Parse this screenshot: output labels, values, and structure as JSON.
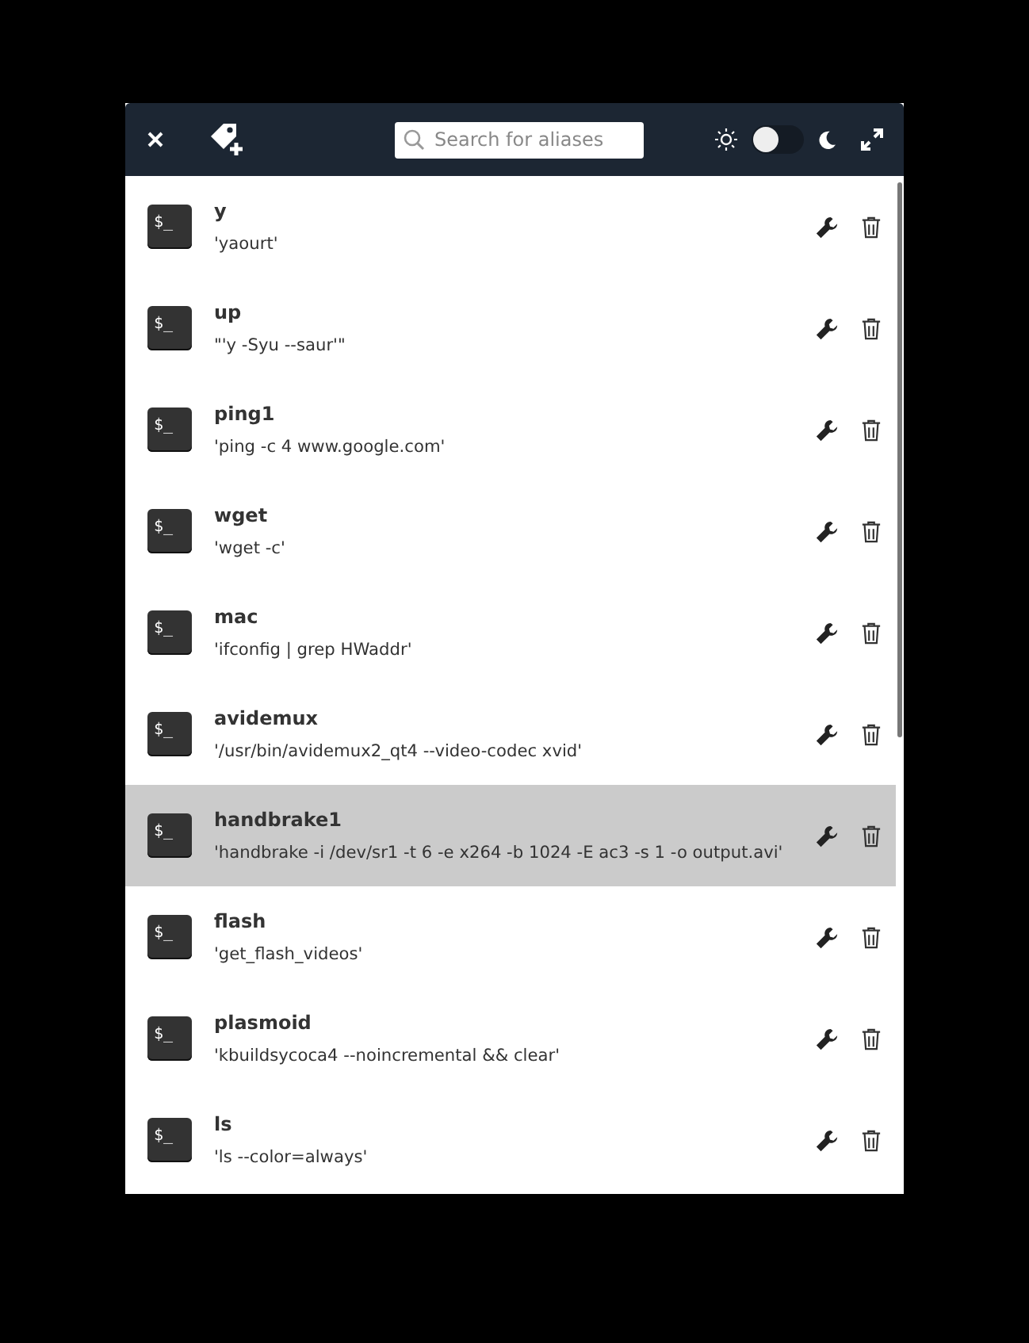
{
  "header": {
    "search": {
      "placeholder": "Search for aliases"
    },
    "dark_mode": false
  },
  "aliases": [
    {
      "name": "y",
      "command": "'yaourt'",
      "icon_text": "$_",
      "selected": false
    },
    {
      "name": "up",
      "command": "\"'y -Syu --saur'\"",
      "icon_text": "$_",
      "selected": false
    },
    {
      "name": "ping1",
      "command": "'ping -c 4 www.google.com'",
      "icon_text": "$_",
      "selected": false
    },
    {
      "name": "wget",
      "command": "'wget -c'",
      "icon_text": "$_",
      "selected": false
    },
    {
      "name": "mac",
      "command": "'ifconfig | grep HWaddr'",
      "icon_text": "$_",
      "selected": false
    },
    {
      "name": "avidemux",
      "command": "'/usr/bin/avidemux2_qt4 --video-codec xvid'",
      "icon_text": "$_",
      "selected": false
    },
    {
      "name": "handbrake1",
      "command": "'handbrake -i /dev/sr1 -t 6 -e x264 -b 1024 -E ac3 -s 1 -o output.avi'",
      "icon_text": "$_",
      "selected": true
    },
    {
      "name": "flash",
      "command": "'get_flash_videos'",
      "icon_text": "$_",
      "selected": false
    },
    {
      "name": "plasmoid",
      "command": "'kbuildsycoca4 --noincremental && clear'",
      "icon_text": "$_",
      "selected": false
    },
    {
      "name": "ls",
      "command": "'ls --color=always'",
      "icon_text": "$_",
      "selected": false
    }
  ]
}
